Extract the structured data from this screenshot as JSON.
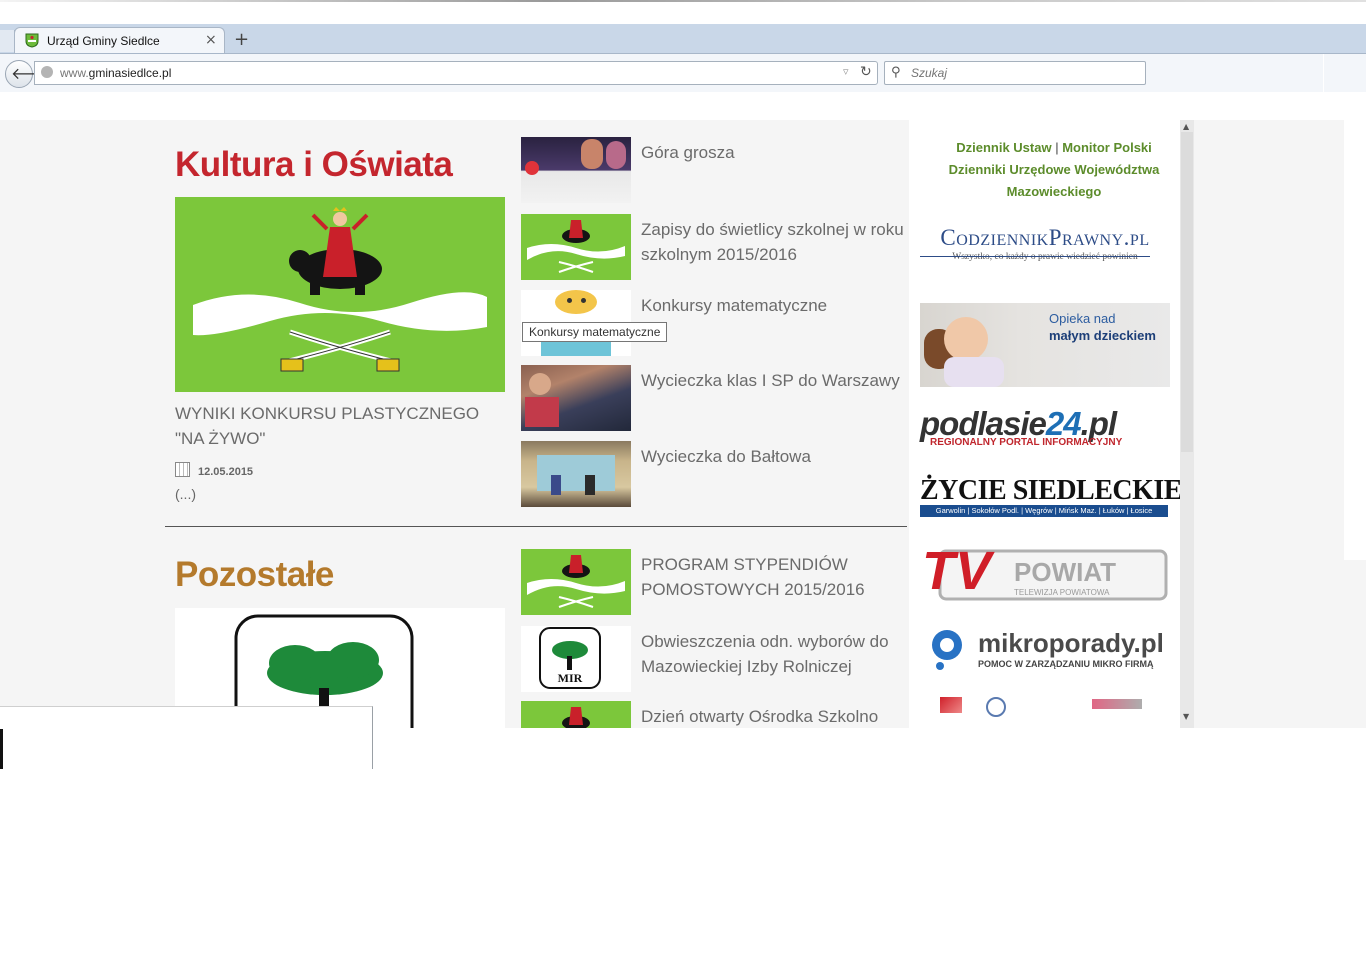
{
  "browser": {
    "tab_title": "Urząd Gminy Siedlce",
    "close_glyph": "×",
    "newtab_glyph": "+",
    "url_prefix": "www.",
    "url_main": "gminasiedlce.pl",
    "search_placeholder": "Szukaj"
  },
  "sections": [
    {
      "title": "Kultura i Oświata",
      "hero_caption": "WYNIKI KONKURSU PLASTYCZNEGO \"NA ŻYWO\"",
      "hero_date": "12.05.2015",
      "hero_more": "(...)",
      "news": [
        {
          "title": "Góra grosza"
        },
        {
          "title": "Zapisy do świetlicy szkolnej w roku szkolnym 2015/2016"
        },
        {
          "title": "Konkursy matematyczne"
        },
        {
          "title": "Wycieczka klas I SP do Warszawy"
        },
        {
          "title": "Wycieczka do Bałtowa"
        }
      ]
    },
    {
      "title": "Pozostałe",
      "news": [
        {
          "title": "PROGRAM STYPENDIÓW POMOSTOWYCH 2015/2016"
        },
        {
          "title": "Obwieszczenia odn. wyborów do Mazowieckiej Izby Rolniczej"
        },
        {
          "title": "Dzień otwarty Ośrodka Szkolno"
        }
      ]
    }
  ],
  "tooltip": "Konkursy matematyczne",
  "sidebar": {
    "link_dziennik": "Dziennik Ustaw",
    "link_separator": "|",
    "link_monitor": "Monitor Polski",
    "link_dzienniki": "Dzienniki Urzędowe Województwa Mazowieckiego",
    "codziennik_logo": "CodziennikPrawny.pl",
    "codziennik_tagline": "Wszystko, co każdy o prawie wiedzieć powinien",
    "opieka_line1": "Opieka nad",
    "opieka_line2": "małym dzieckiem",
    "podlasie_a": "podlasie",
    "podlasie_b": "24",
    "podlasie_c": ".pl",
    "podlasie_sub": "REGIONALNY PORTAL INFORMACYJNY",
    "zycie_title": "ŻYCIE SIEDLECKIE",
    "zycie_towns": "Garwolin | Sokołów Podl. | Węgrów | Mińsk Maz. | Łuków | Łosice",
    "tv_big": "TV",
    "tv_word": "POWIAT",
    "tv_sub": "TELEWIZJA POWIATOWA",
    "mikro_title": "mikroporady.pl",
    "mikro_sub": "POMOC W ZARZĄDZANIU MIKRO FIRMĄ"
  },
  "colors": {
    "kultura_title": "#c4262e",
    "pozostale_title": "#b47a2c",
    "sidebar_links": "#5c8c2b",
    "flag_green": "#7cc73b"
  },
  "icons": {
    "back": "back-arrow-icon",
    "reload": "reload-icon",
    "search": "magnifier-icon",
    "calendar": "calendar-icon"
  }
}
